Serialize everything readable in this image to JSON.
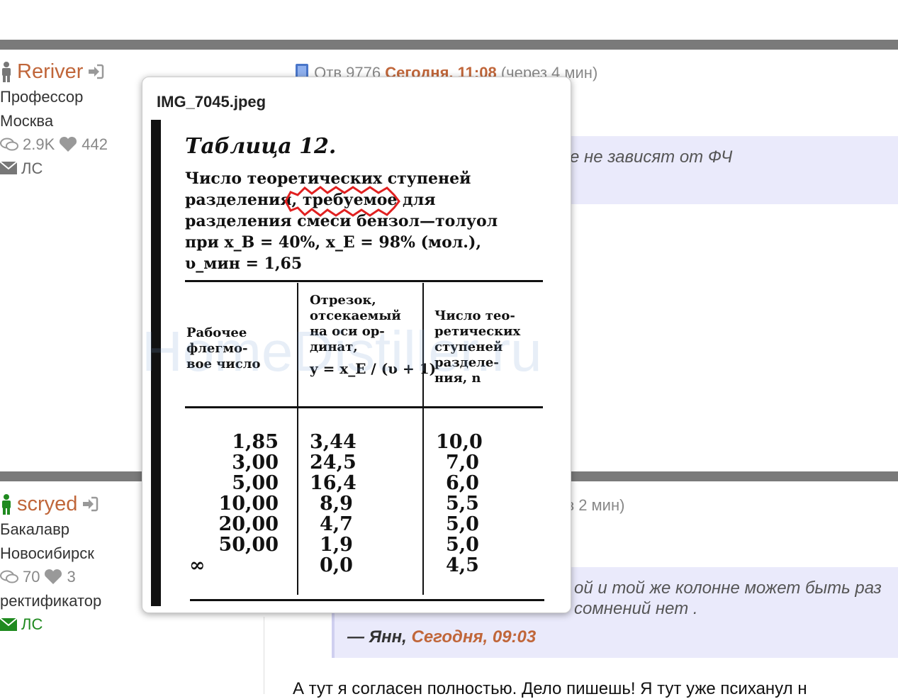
{
  "posts": [
    {
      "author": "Reriver",
      "rank": "Профессор",
      "city": "Москва",
      "messages": "2.9K",
      "likes": "442",
      "pm_label": "ЛС",
      "meta_prefix": "Отв 9776",
      "meta_today": "Сегодня, 11:08",
      "meta_suffix": "(через 4 мин)",
      "quote_text": "е не зависят от ФЧ"
    },
    {
      "author": "scryed",
      "rank": "Бакалавр",
      "city": "Новосибирск",
      "messages": "70",
      "likes": "3",
      "role": "ректификатор",
      "pm_label": "ЛС",
      "meta_suffix": "з 2 мин)",
      "quote_line1": "ой и той же колонне может быть раз",
      "quote_line2": "сомнений нет .",
      "quote_author": "— Янн,",
      "quote_when": "Сегодня, 09:03",
      "body": "А тут я согласен полностью. Дело пишешь! Я тут уже психанул н"
    }
  ],
  "popup": {
    "filename": "IMG_7045.jpeg",
    "table_title": "Таблица 12.",
    "caption": [
      "Число теоретических ступеней",
      "разделения, требуемое для",
      "разделения смеси бензол—толуол",
      "при x_B = 40%, x_E = 98% (мол.),",
      "υ_мин = 1,65"
    ],
    "headers": {
      "col1": [
        "Рабочее",
        "флегмо-",
        "вое число"
      ],
      "col2": [
        "Отрезок,",
        "отсекаемый",
        "на оси ор-",
        "динат,",
        "y = x_E / (υ + 1)"
      ],
      "col3": [
        "Число тео-",
        "ретических",
        "ступеней",
        "разделе-",
        "ния, n"
      ]
    },
    "rows": [
      [
        "1,85",
        "3,44",
        "10,0"
      ],
      [
        "3,00",
        "24,5",
        "7,0"
      ],
      [
        "5,00",
        "16,4",
        "6,0"
      ],
      [
        "10,00",
        "8,9",
        "5,5"
      ],
      [
        "20,00",
        "4,7",
        "5,0"
      ],
      [
        "50,00",
        "1,9",
        "5,0"
      ],
      [
        "∞",
        "0,0",
        "4,5"
      ]
    ],
    "watermark": "HomeDistiller.ru"
  }
}
